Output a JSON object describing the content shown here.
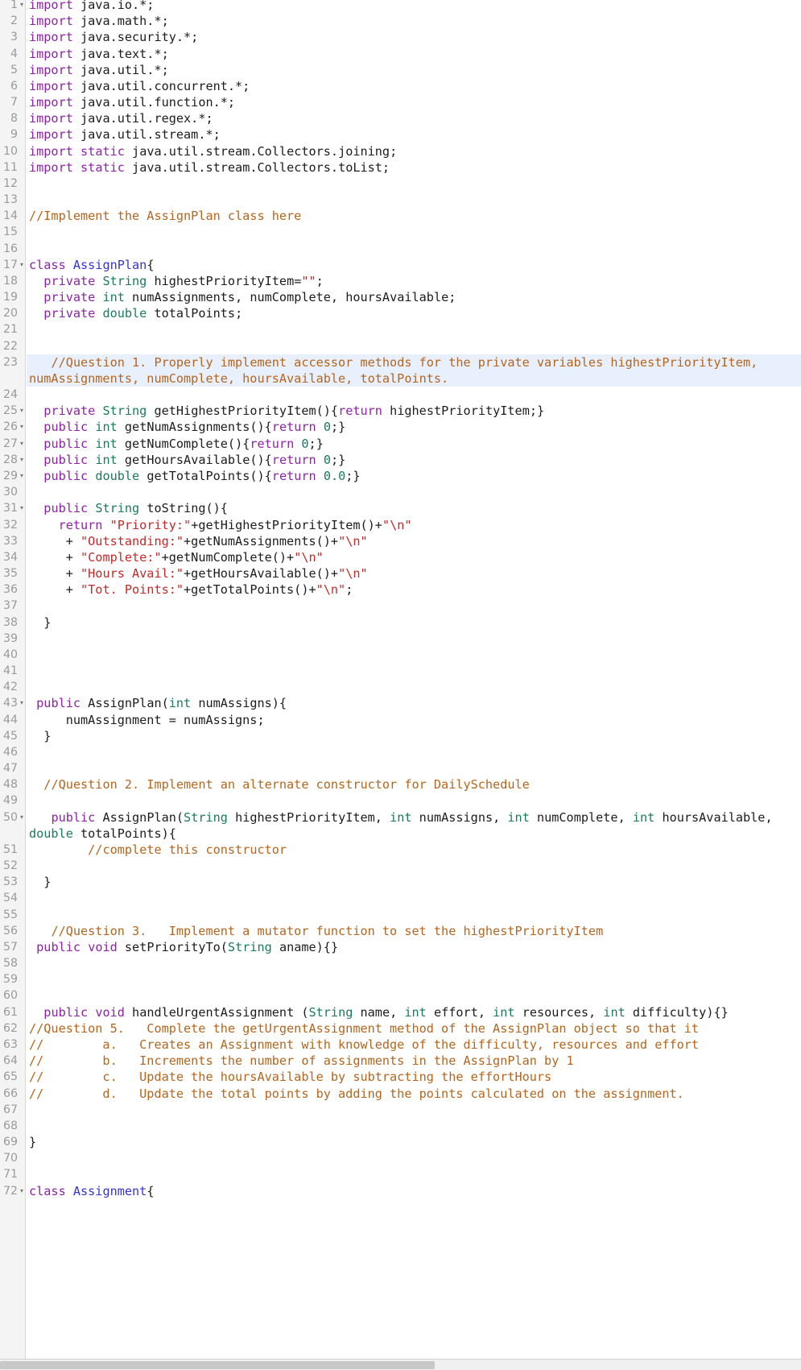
{
  "editor": {
    "language": "java",
    "accent_highlight_color": "#e8f0fd",
    "gutter_color": "#f4f4f4",
    "colors": {
      "keyword": "#8e22a8",
      "type": "#1a7a5e",
      "class_name": "#3434cf",
      "string": "#c62828",
      "comment": "#b5651d",
      "text": "#1c1c1c",
      "line_number": "#9a9a9a"
    },
    "first_visible_line": 1,
    "last_visible_line": 72,
    "highlighted_line": 23
  },
  "lines": [
    {
      "n": 1,
      "fold": true,
      "clipped": true,
      "tokens": [
        {
          "t": "import",
          "c": "kw"
        },
        {
          "t": " java.io.*;",
          "c": "plain"
        }
      ]
    },
    {
      "n": 2,
      "fold": false,
      "tokens": [
        {
          "t": "import",
          "c": "kw"
        },
        {
          "t": " java.math.*;",
          "c": "plain"
        }
      ]
    },
    {
      "n": 3,
      "fold": false,
      "tokens": [
        {
          "t": "import",
          "c": "kw"
        },
        {
          "t": " java.security.*;",
          "c": "plain"
        }
      ]
    },
    {
      "n": 4,
      "fold": false,
      "tokens": [
        {
          "t": "import",
          "c": "kw"
        },
        {
          "t": " java.text.*;",
          "c": "plain"
        }
      ]
    },
    {
      "n": 5,
      "fold": false,
      "tokens": [
        {
          "t": "import",
          "c": "kw"
        },
        {
          "t": " java.util.*;",
          "c": "plain"
        }
      ]
    },
    {
      "n": 6,
      "fold": false,
      "tokens": [
        {
          "t": "import",
          "c": "kw"
        },
        {
          "t": " java.util.concurrent.*;",
          "c": "plain"
        }
      ]
    },
    {
      "n": 7,
      "fold": false,
      "tokens": [
        {
          "t": "import",
          "c": "kw"
        },
        {
          "t": " java.util.function.*;",
          "c": "plain"
        }
      ]
    },
    {
      "n": 8,
      "fold": false,
      "tokens": [
        {
          "t": "import",
          "c": "kw"
        },
        {
          "t": " java.util.regex.*;",
          "c": "plain"
        }
      ]
    },
    {
      "n": 9,
      "fold": false,
      "tokens": [
        {
          "t": "import",
          "c": "kw"
        },
        {
          "t": " java.util.stream.*;",
          "c": "plain"
        }
      ]
    },
    {
      "n": 10,
      "fold": false,
      "tokens": [
        {
          "t": "import",
          "c": "kw"
        },
        {
          "t": " ",
          "c": "plain"
        },
        {
          "t": "static",
          "c": "kw"
        },
        {
          "t": " java.util.stream.Collectors.joining;",
          "c": "plain"
        }
      ]
    },
    {
      "n": 11,
      "fold": false,
      "tokens": [
        {
          "t": "import",
          "c": "kw"
        },
        {
          "t": " ",
          "c": "plain"
        },
        {
          "t": "static",
          "c": "kw"
        },
        {
          "t": " java.util.stream.Collectors.toList;",
          "c": "plain"
        }
      ]
    },
    {
      "n": 12,
      "fold": false,
      "tokens": []
    },
    {
      "n": 13,
      "fold": false,
      "tokens": []
    },
    {
      "n": 14,
      "fold": false,
      "tokens": [
        {
          "t": "//Implement the AssignPlan class here",
          "c": "cmt"
        }
      ]
    },
    {
      "n": 15,
      "fold": false,
      "tokens": []
    },
    {
      "n": 16,
      "fold": false,
      "tokens": []
    },
    {
      "n": 17,
      "fold": true,
      "tokens": [
        {
          "t": "class",
          "c": "kw"
        },
        {
          "t": " ",
          "c": "plain"
        },
        {
          "t": "AssignPlan",
          "c": "cls"
        },
        {
          "t": "{",
          "c": "plain"
        }
      ]
    },
    {
      "n": 18,
      "fold": false,
      "tokens": [
        {
          "t": "  ",
          "c": "plain"
        },
        {
          "t": "private",
          "c": "kw"
        },
        {
          "t": " ",
          "c": "plain"
        },
        {
          "t": "String",
          "c": "typ"
        },
        {
          "t": " highestPriorityItem=",
          "c": "plain"
        },
        {
          "t": "\"\"",
          "c": "str"
        },
        {
          "t": ";",
          "c": "plain"
        }
      ]
    },
    {
      "n": 19,
      "fold": false,
      "tokens": [
        {
          "t": "  ",
          "c": "plain"
        },
        {
          "t": "private",
          "c": "kw"
        },
        {
          "t": " ",
          "c": "plain"
        },
        {
          "t": "int",
          "c": "typ"
        },
        {
          "t": " numAssignments, numComplete, hoursAvailable;",
          "c": "plain"
        }
      ]
    },
    {
      "n": 20,
      "fold": false,
      "tokens": [
        {
          "t": "  ",
          "c": "plain"
        },
        {
          "t": "private",
          "c": "kw"
        },
        {
          "t": " ",
          "c": "plain"
        },
        {
          "t": "double",
          "c": "typ"
        },
        {
          "t": " totalPoints;",
          "c": "plain"
        }
      ]
    },
    {
      "n": 21,
      "fold": false,
      "tokens": []
    },
    {
      "n": 22,
      "fold": false,
      "tokens": []
    },
    {
      "n": 23,
      "fold": false,
      "highlight": true,
      "tokens": [
        {
          "t": "   //Question 1. Properly implement accessor methods for the private variables highestPriorityItem, numAssignments, numComplete, hoursAvailable, totalPoints.",
          "c": "cmt"
        }
      ]
    },
    {
      "n": 24,
      "fold": false,
      "tokens": []
    },
    {
      "n": 25,
      "fold": true,
      "tokens": [
        {
          "t": "  ",
          "c": "plain"
        },
        {
          "t": "private",
          "c": "kw"
        },
        {
          "t": " ",
          "c": "plain"
        },
        {
          "t": "String",
          "c": "typ"
        },
        {
          "t": " getHighestPriorityItem(){",
          "c": "plain"
        },
        {
          "t": "return",
          "c": "kw"
        },
        {
          "t": " highestPriorityItem;}",
          "c": "plain"
        }
      ]
    },
    {
      "n": 26,
      "fold": true,
      "tokens": [
        {
          "t": "  ",
          "c": "plain"
        },
        {
          "t": "public",
          "c": "kw"
        },
        {
          "t": " ",
          "c": "plain"
        },
        {
          "t": "int",
          "c": "typ"
        },
        {
          "t": " getNumAssignments(){",
          "c": "plain"
        },
        {
          "t": "return",
          "c": "kw"
        },
        {
          "t": " ",
          "c": "plain"
        },
        {
          "t": "0",
          "c": "typ"
        },
        {
          "t": ";}",
          "c": "plain"
        }
      ]
    },
    {
      "n": 27,
      "fold": true,
      "tokens": [
        {
          "t": "  ",
          "c": "plain"
        },
        {
          "t": "public",
          "c": "kw"
        },
        {
          "t": " ",
          "c": "plain"
        },
        {
          "t": "int",
          "c": "typ"
        },
        {
          "t": " getNumComplete(){",
          "c": "plain"
        },
        {
          "t": "return",
          "c": "kw"
        },
        {
          "t": " ",
          "c": "plain"
        },
        {
          "t": "0",
          "c": "typ"
        },
        {
          "t": ";}",
          "c": "plain"
        }
      ]
    },
    {
      "n": 28,
      "fold": true,
      "tokens": [
        {
          "t": "  ",
          "c": "plain"
        },
        {
          "t": "public",
          "c": "kw"
        },
        {
          "t": " ",
          "c": "plain"
        },
        {
          "t": "int",
          "c": "typ"
        },
        {
          "t": " getHoursAvailable(){",
          "c": "plain"
        },
        {
          "t": "return",
          "c": "kw"
        },
        {
          "t": " ",
          "c": "plain"
        },
        {
          "t": "0",
          "c": "typ"
        },
        {
          "t": ";}",
          "c": "plain"
        }
      ]
    },
    {
      "n": 29,
      "fold": true,
      "tokens": [
        {
          "t": "  ",
          "c": "plain"
        },
        {
          "t": "public",
          "c": "kw"
        },
        {
          "t": " ",
          "c": "plain"
        },
        {
          "t": "double",
          "c": "typ"
        },
        {
          "t": " getTotalPoints(){",
          "c": "plain"
        },
        {
          "t": "return",
          "c": "kw"
        },
        {
          "t": " ",
          "c": "plain"
        },
        {
          "t": "0.0",
          "c": "typ"
        },
        {
          "t": ";}",
          "c": "plain"
        }
      ]
    },
    {
      "n": 30,
      "fold": false,
      "tokens": []
    },
    {
      "n": 31,
      "fold": true,
      "tokens": [
        {
          "t": "  ",
          "c": "plain"
        },
        {
          "t": "public",
          "c": "kw"
        },
        {
          "t": " ",
          "c": "plain"
        },
        {
          "t": "String",
          "c": "typ"
        },
        {
          "t": " toString(){",
          "c": "plain"
        }
      ]
    },
    {
      "n": 32,
      "fold": false,
      "tokens": [
        {
          "t": "    ",
          "c": "plain"
        },
        {
          "t": "return",
          "c": "kw"
        },
        {
          "t": " ",
          "c": "plain"
        },
        {
          "t": "\"Priority:\"",
          "c": "str"
        },
        {
          "t": "+getHighestPriorityItem()+",
          "c": "plain"
        },
        {
          "t": "\"\\n\"",
          "c": "str"
        }
      ]
    },
    {
      "n": 33,
      "fold": false,
      "tokens": [
        {
          "t": "     + ",
          "c": "plain"
        },
        {
          "t": "\"Outstanding:\"",
          "c": "str"
        },
        {
          "t": "+getNumAssignments()+",
          "c": "plain"
        },
        {
          "t": "\"\\n\"",
          "c": "str"
        }
      ]
    },
    {
      "n": 34,
      "fold": false,
      "tokens": [
        {
          "t": "     + ",
          "c": "plain"
        },
        {
          "t": "\"Complete:\"",
          "c": "str"
        },
        {
          "t": "+getNumComplete()+",
          "c": "plain"
        },
        {
          "t": "\"\\n\"",
          "c": "str"
        }
      ]
    },
    {
      "n": 35,
      "fold": false,
      "tokens": [
        {
          "t": "     + ",
          "c": "plain"
        },
        {
          "t": "\"Hours Avail:\"",
          "c": "str"
        },
        {
          "t": "+getHoursAvailable()+",
          "c": "plain"
        },
        {
          "t": "\"\\n\"",
          "c": "str"
        }
      ]
    },
    {
      "n": 36,
      "fold": false,
      "tokens": [
        {
          "t": "     + ",
          "c": "plain"
        },
        {
          "t": "\"Tot. Points:\"",
          "c": "str"
        },
        {
          "t": "+getTotalPoints()+",
          "c": "plain"
        },
        {
          "t": "\"\\n\"",
          "c": "str"
        },
        {
          "t": ";",
          "c": "plain"
        }
      ]
    },
    {
      "n": 37,
      "fold": false,
      "tokens": []
    },
    {
      "n": 38,
      "fold": false,
      "tokens": [
        {
          "t": "  }",
          "c": "plain"
        }
      ]
    },
    {
      "n": 39,
      "fold": false,
      "tokens": []
    },
    {
      "n": 40,
      "fold": false,
      "tokens": []
    },
    {
      "n": 41,
      "fold": false,
      "tokens": []
    },
    {
      "n": 42,
      "fold": false,
      "tokens": []
    },
    {
      "n": 43,
      "fold": true,
      "tokens": [
        {
          "t": " ",
          "c": "plain"
        },
        {
          "t": "public",
          "c": "kw"
        },
        {
          "t": " AssignPlan(",
          "c": "plain"
        },
        {
          "t": "int",
          "c": "typ"
        },
        {
          "t": " numAssigns){",
          "c": "plain"
        }
      ]
    },
    {
      "n": 44,
      "fold": false,
      "tokens": [
        {
          "t": "     numAssignment = numAssigns;",
          "c": "plain"
        }
      ]
    },
    {
      "n": 45,
      "fold": false,
      "tokens": [
        {
          "t": "  }",
          "c": "plain"
        }
      ]
    },
    {
      "n": 46,
      "fold": false,
      "tokens": []
    },
    {
      "n": 47,
      "fold": false,
      "tokens": []
    },
    {
      "n": 48,
      "fold": false,
      "tokens": [
        {
          "t": "  //Question 2. Implement an alternate constructor for DailySchedule",
          "c": "cmt"
        }
      ]
    },
    {
      "n": 49,
      "fold": false,
      "tokens": []
    },
    {
      "n": 50,
      "fold": true,
      "tokens": [
        {
          "t": "   ",
          "c": "plain"
        },
        {
          "t": "public",
          "c": "kw"
        },
        {
          "t": " AssignPlan(",
          "c": "plain"
        },
        {
          "t": "String",
          "c": "typ"
        },
        {
          "t": " highestPriorityItem, ",
          "c": "plain"
        },
        {
          "t": "int",
          "c": "typ"
        },
        {
          "t": " numAssigns, ",
          "c": "plain"
        },
        {
          "t": "int",
          "c": "typ"
        },
        {
          "t": " numComplete, ",
          "c": "plain"
        },
        {
          "t": "int",
          "c": "typ"
        },
        {
          "t": " hoursAvailable, ",
          "c": "plain"
        },
        {
          "t": "double",
          "c": "typ"
        },
        {
          "t": " totalPoints){",
          "c": "plain"
        }
      ]
    },
    {
      "n": 51,
      "fold": false,
      "tokens": [
        {
          "t": "        //complete this constructor",
          "c": "cmt"
        }
      ]
    },
    {
      "n": 52,
      "fold": false,
      "tokens": []
    },
    {
      "n": 53,
      "fold": false,
      "tokens": [
        {
          "t": "  }",
          "c": "plain"
        }
      ]
    },
    {
      "n": 54,
      "fold": false,
      "tokens": []
    },
    {
      "n": 55,
      "fold": false,
      "tokens": []
    },
    {
      "n": 56,
      "fold": false,
      "tokens": [
        {
          "t": "   //Question 3.   Implement a mutator function to set the highestPriorityItem",
          "c": "cmt"
        }
      ]
    },
    {
      "n": 57,
      "fold": false,
      "tokens": [
        {
          "t": " ",
          "c": "plain"
        },
        {
          "t": "public",
          "c": "kw"
        },
        {
          "t": " ",
          "c": "plain"
        },
        {
          "t": "void",
          "c": "kw"
        },
        {
          "t": " setPriorityTo(",
          "c": "plain"
        },
        {
          "t": "String",
          "c": "typ"
        },
        {
          "t": " aname){}",
          "c": "plain"
        }
      ]
    },
    {
      "n": 58,
      "fold": false,
      "tokens": []
    },
    {
      "n": 59,
      "fold": false,
      "tokens": []
    },
    {
      "n": 60,
      "fold": false,
      "tokens": []
    },
    {
      "n": 61,
      "fold": false,
      "tokens": [
        {
          "t": "  ",
          "c": "plain"
        },
        {
          "t": "public",
          "c": "kw"
        },
        {
          "t": " ",
          "c": "plain"
        },
        {
          "t": "void",
          "c": "kw"
        },
        {
          "t": " handleUrgentAssignment (",
          "c": "plain"
        },
        {
          "t": "String",
          "c": "typ"
        },
        {
          "t": " name, ",
          "c": "plain"
        },
        {
          "t": "int",
          "c": "typ"
        },
        {
          "t": " effort, ",
          "c": "plain"
        },
        {
          "t": "int",
          "c": "typ"
        },
        {
          "t": " resources, ",
          "c": "plain"
        },
        {
          "t": "int",
          "c": "typ"
        },
        {
          "t": " difficulty){}",
          "c": "plain"
        }
      ]
    },
    {
      "n": 62,
      "fold": false,
      "tokens": [
        {
          "t": "//Question 5.   Complete the getUrgentAssignment method of the AssignPlan object so that it",
          "c": "cmt"
        }
      ]
    },
    {
      "n": 63,
      "fold": false,
      "tokens": [
        {
          "t": "//        a.   Creates an Assignment with knowledge of the difficulty, resources and effort",
          "c": "cmt"
        }
      ]
    },
    {
      "n": 64,
      "fold": false,
      "tokens": [
        {
          "t": "//        b.   Increments the number of assignments in the AssignPlan by 1",
          "c": "cmt"
        }
      ]
    },
    {
      "n": 65,
      "fold": false,
      "tokens": [
        {
          "t": "//        c.   Update the hoursAvailable by subtracting the effortHours",
          "c": "cmt"
        }
      ]
    },
    {
      "n": 66,
      "fold": false,
      "tokens": [
        {
          "t": "//        d.   Update the total points by adding the points calculated on the assignment.",
          "c": "cmt"
        }
      ]
    },
    {
      "n": 67,
      "fold": false,
      "tokens": []
    },
    {
      "n": 68,
      "fold": false,
      "tokens": []
    },
    {
      "n": 69,
      "fold": false,
      "tokens": [
        {
          "t": "}",
          "c": "plain"
        }
      ]
    },
    {
      "n": 70,
      "fold": false,
      "tokens": []
    },
    {
      "n": 71,
      "fold": false,
      "tokens": []
    },
    {
      "n": 72,
      "fold": true,
      "tokens": [
        {
          "t": "class",
          "c": "kw"
        },
        {
          "t": " ",
          "c": "plain"
        },
        {
          "t": "Assignment",
          "c": "cls"
        },
        {
          "t": "{",
          "c": "plain"
        }
      ]
    }
  ],
  "scrollbar": {
    "orientation": "horizontal",
    "thumb_position": "left"
  }
}
